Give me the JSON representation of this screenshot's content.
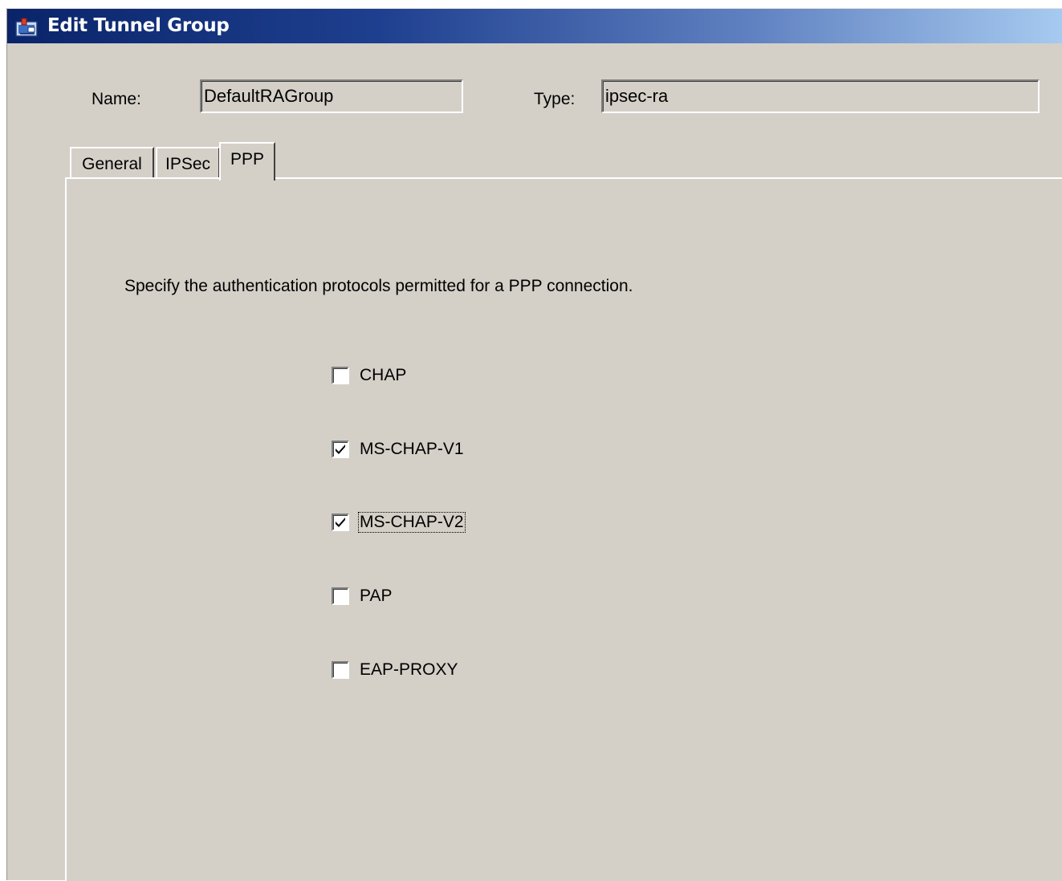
{
  "window": {
    "title": "Edit Tunnel Group",
    "title_icon": "tunnel-group-icon"
  },
  "form": {
    "name_label": "Name:",
    "name_value": "DefaultRAGroup",
    "type_label": "Type:",
    "type_value": "ipsec-ra"
  },
  "tabs": [
    {
      "label": "General",
      "active": false
    },
    {
      "label": "IPSec",
      "active": false
    },
    {
      "label": "PPP",
      "active": true
    }
  ],
  "ppp": {
    "instruction": "Specify the authentication protocols permitted for a PPP connection.",
    "protocols": [
      {
        "label": "CHAP",
        "checked": false
      },
      {
        "label": "MS-CHAP-V1",
        "checked": true
      },
      {
        "label": "MS-CHAP-V2",
        "checked": true,
        "focused": true
      },
      {
        "label": "PAP",
        "checked": false
      },
      {
        "label": "EAP-PROXY",
        "checked": false
      }
    ]
  },
  "colors": {
    "titlebar_start": "#0a246a",
    "titlebar_end": "#a6caf0",
    "dialog_bg": "#d4d0c8"
  }
}
